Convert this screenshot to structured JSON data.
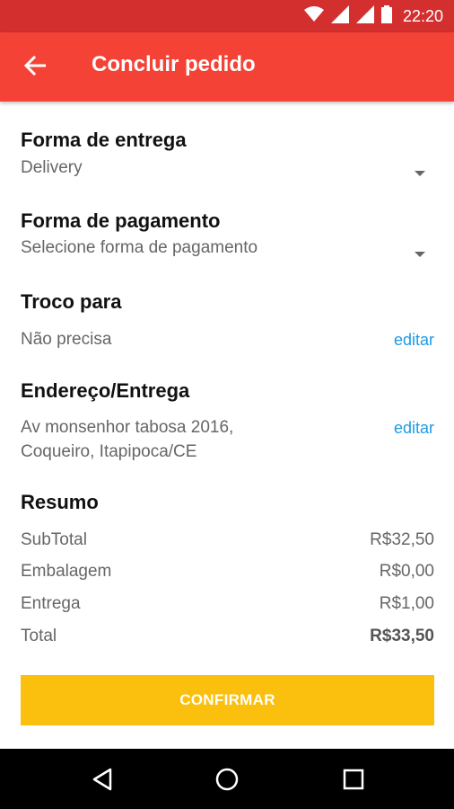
{
  "status_bar": {
    "time": "22:20",
    "icons": [
      "wifi-icon",
      "signal-icon",
      "signal-icon",
      "battery-icon"
    ]
  },
  "header": {
    "title": "Concluir pedido",
    "back_icon": "arrow-left-icon"
  },
  "delivery": {
    "title": "Forma de entrega",
    "value": "Delivery"
  },
  "payment": {
    "title": "Forma de pagamento",
    "placeholder": "Selecione forma de pagamento"
  },
  "change": {
    "title": "Troco para",
    "value": "Não precisa",
    "edit_label": "editar"
  },
  "address": {
    "title": "Endereço/Entrega",
    "line1": "Av monsenhor tabosa 2016,",
    "line2": "Coqueiro, Itapipoca/CE",
    "edit_label": "editar"
  },
  "summary": {
    "title": "Resumo",
    "rows": [
      {
        "label": "SubTotal",
        "value": "R$32,50"
      },
      {
        "label": "Embalagem",
        "value": "R$0,00"
      },
      {
        "label": "Entrega",
        "value": "R$1,00"
      },
      {
        "label": "Total",
        "value": "R$33,50"
      }
    ]
  },
  "confirm_label": "CONFIRMAR",
  "colors": {
    "status_bar": "#d32f2f",
    "app_bar": "#f44336",
    "accent_link": "#1e9be5",
    "confirm_button": "#fbbf0e"
  },
  "nav": {
    "back": "back-triangle-icon",
    "home": "home-circle-icon",
    "recents": "recents-square-icon"
  }
}
